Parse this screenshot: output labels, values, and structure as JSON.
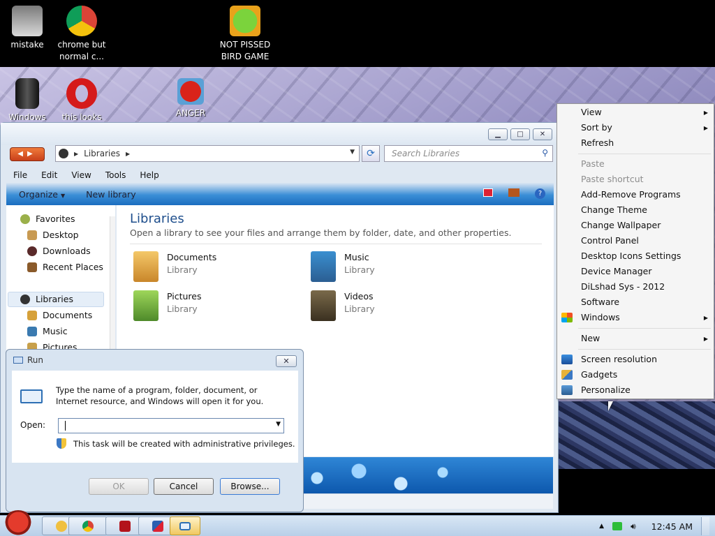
{
  "desktop": {
    "icons": [
      {
        "label": "mistake"
      },
      {
        "label": "chrome but normal c..."
      },
      {
        "label": "NOT PISSED BIRD GAME"
      },
      {
        "label": "Windows"
      },
      {
        "label": "this looks"
      },
      {
        "label": "ANGER"
      }
    ]
  },
  "explorer": {
    "address_segment": "Libraries",
    "search_placeholder": "Search Libraries",
    "menu": [
      "File",
      "Edit",
      "View",
      "Tools",
      "Help"
    ],
    "toolbar": {
      "organize": "Organize",
      "new_library": "New library"
    },
    "nav": {
      "favorites": "Favorites",
      "desktop": "Desktop",
      "downloads": "Downloads",
      "recent_places": "Recent Places",
      "libraries": "Libraries",
      "documents": "Documents",
      "music": "Music",
      "pictures": "Pictures"
    },
    "heading": "Libraries",
    "subheading": "Open a library to see your files and arrange them by folder, date, and other properties.",
    "libraries": [
      {
        "name": "Documents",
        "type": "Library"
      },
      {
        "name": "Music",
        "type": "Library"
      },
      {
        "name": "Pictures",
        "type": "Library"
      },
      {
        "name": "Videos",
        "type": "Library"
      }
    ]
  },
  "run_dialog": {
    "title": "Run",
    "message": "Type the name of a program, folder, document, or Internet resource, and Windows will open it for you.",
    "open_label": "Open:",
    "open_value": "",
    "admin_note": "This task will be created with administrative privileges.",
    "ok": "OK",
    "cancel": "Cancel",
    "browse": "Browse..."
  },
  "context_menu": {
    "view": "View",
    "sort_by": "Sort by",
    "refresh": "Refresh",
    "paste": "Paste",
    "paste_shortcut": "Paste shortcut",
    "add_remove": "Add-Remove Programs",
    "change_theme": "Change Theme",
    "change_wallpaper": "Change Wallpaper",
    "control_panel": "Control Panel",
    "desktop_icons": "Desktop Icons Settings",
    "device_manager": "Device Manager",
    "dilshad": "DiLshad Sys - 2012",
    "software": "Software",
    "windows": "Windows",
    "new": "New",
    "screen_resolution": "Screen resolution",
    "gadgets": "Gadgets",
    "personalize": "Personalize"
  },
  "taskbar": {
    "clock": "12:45 AM"
  }
}
